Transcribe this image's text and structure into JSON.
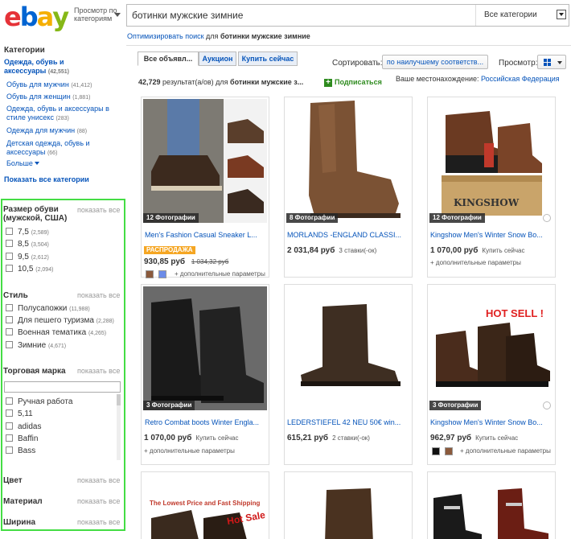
{
  "header": {
    "logo": {
      "e": "e",
      "b": "b",
      "a": "a",
      "y": "y"
    },
    "browse_label_1": "Просмотр по",
    "browse_label_2": "категориям",
    "search_value": "ботинки мужские зимние",
    "category_select": "Все категории",
    "optimize_prefix": "Оптимизировать поиск",
    "optimize_mid": " для ",
    "optimize_query": "ботинки мужские зимние"
  },
  "sidebar": {
    "categories_title": "Категории",
    "top_category": "Одежда, обувь и аксессуары",
    "top_category_count": "(42,551)",
    "items": [
      {
        "label": "Обувь для мужчин",
        "count": "(41,412)"
      },
      {
        "label": "Обувь для женщин",
        "count": "(1,881)"
      },
      {
        "label": "Одежда, обувь и аксессуары в стиле унисекс",
        "count": "(283)"
      },
      {
        "label": "Одежда для мужчин",
        "count": "(88)"
      },
      {
        "label": "Детская одежда, обувь и аксессуары",
        "count": "(66)"
      }
    ],
    "more": "Больше",
    "show_all": "Показать все категории",
    "show_all_short": "показать все",
    "size_title_1": "Размер обуви",
    "size_title_2": "(мужской, США)",
    "sizes": [
      {
        "label": "7,5",
        "count": "(2,589)"
      },
      {
        "label": "8,5",
        "count": "(3,504)"
      },
      {
        "label": "9,5",
        "count": "(2,612)"
      },
      {
        "label": "10,5",
        "count": "(2,094)"
      }
    ],
    "style_title": "Стиль",
    "styles": [
      {
        "label": "Полусапожки",
        "count": "(11,988)"
      },
      {
        "label": "Для пешего туризма",
        "count": "(2,288)"
      },
      {
        "label": "Военная тематика",
        "count": "(4,265)"
      },
      {
        "label": "Зимние",
        "count": "(4,671)"
      }
    ],
    "brand_title": "Торговая марка",
    "brands": [
      "Ручная работа",
      "5,11",
      "adidas",
      "Baffin",
      "Bass"
    ],
    "color_title": "Цвет",
    "material_title": "Материал",
    "width_title": "Ширина"
  },
  "toolbar": {
    "tabs": [
      "Все объявл...",
      "Аукцион",
      "Купить сейчас"
    ],
    "sort_label": "Сортировать:",
    "sort_value": "по наилучшему соответств...",
    "view_label": "Просмотр:",
    "results_count": "42,729",
    "results_mid": " результат(а/ов) для ",
    "results_query": "ботинки мужские з...",
    "subscribe": "Подписаться",
    "location_label": "Ваше местонахождение: ",
    "location_value": "Российская Федерация"
  },
  "cards": [
    {
      "badge": "12 Фотографии",
      "title": "Men's Fashion Casual Sneaker L...",
      "price": "930,85 руб",
      "old_price": "1 034,32 руб",
      "sale": "РАСПРОДАЖА",
      "more": "+ дополнительные параметры"
    },
    {
      "badge": "8 Фотографии",
      "title": "MORLANDS -ENGLAND CLASSI...",
      "price": "2 031,84 руб",
      "meta": "3 ставки(-ок)"
    },
    {
      "badge": "12 Фотографии",
      "title": "Kingshow Men's Winter Snow Bo...",
      "price": "1 070,00 руб",
      "meta": "Купить сейчас",
      "more": "+ дополнительные параметры",
      "box_text": "KINGSHOW"
    },
    {
      "badge": "3 Фотографии",
      "title": "Retro Combat boots Winter Engla...",
      "price": "1 070,00 руб",
      "meta": "Купить сейчас",
      "more": "+ дополнительные параметры"
    },
    {
      "title": "LEDERSTIEFEL 42 NEU 50€ win...",
      "price": "615,21 руб",
      "meta": "2 ставки(-ок)"
    },
    {
      "badge": "3 Фотографии",
      "title": "Kingshow Men's Winter Snow Bo...",
      "price": "962,97 руб",
      "meta": "Купить сейчас",
      "more": "+ дополнительные параметры",
      "hot": "HOT SELL !"
    },
    {
      "banner": "The Lowest Price and Fast Shipping",
      "hot": "Hot Sale"
    },
    {},
    {}
  ],
  "colors": {
    "accent_link": "#0654ba",
    "highlight_border": "#44dd44",
    "sale": "#f5a623",
    "subscribe": "#2e8b1e"
  }
}
